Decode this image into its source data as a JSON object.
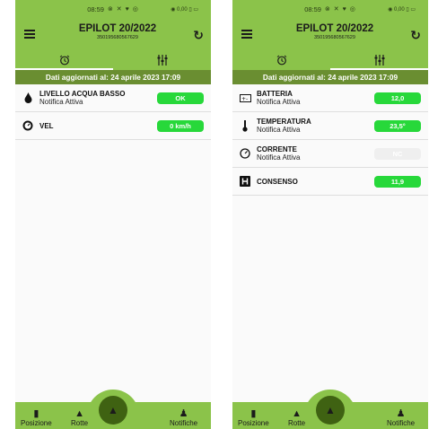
{
  "status": {
    "time": "08:59",
    "left_icons": "⊗ ✕ ♥ ◎",
    "right_icons": "◉ 0,00 ▯ ▭"
  },
  "app": {
    "title": "EPILOT 20/2022",
    "subtitle": "350195680567629"
  },
  "icons": {
    "menu": "menu-icon",
    "refresh": "refresh-icon",
    "tab1": "alarm-clock-icon",
    "tab2": "sliders-icon"
  },
  "update_bar": "Dati aggiornati al: 24 aprile 2023 17:09",
  "left_screen": {
    "rows": [
      {
        "title": "LIVELLO ACQUA BASSO",
        "sub": "Notifica Attiva",
        "value": "OK"
      },
      {
        "title": "VEL",
        "sub": "",
        "value": "0 km/h"
      }
    ]
  },
  "right_screen": {
    "rows": [
      {
        "title": "BATTERIA",
        "sub": "Notifica Attiva",
        "value": "12,0"
      },
      {
        "title": "TEMPERATURA",
        "sub": "Notifica Attiva",
        "value": "23,5°"
      },
      {
        "title": "CORRENTE",
        "sub": "Notifica Attiva",
        "value": "NC"
      },
      {
        "title": "CONSENSO",
        "sub": "",
        "value": "11,9"
      }
    ]
  },
  "nav": {
    "posizione": "Posizione",
    "rotte": "Rotte",
    "notifiche": "Notifiche"
  },
  "colors": {
    "accent": "#8bc34a",
    "dark_accent": "#6a8e31",
    "badge_green": "#27d83a",
    "badge_nc": "#efefef"
  }
}
